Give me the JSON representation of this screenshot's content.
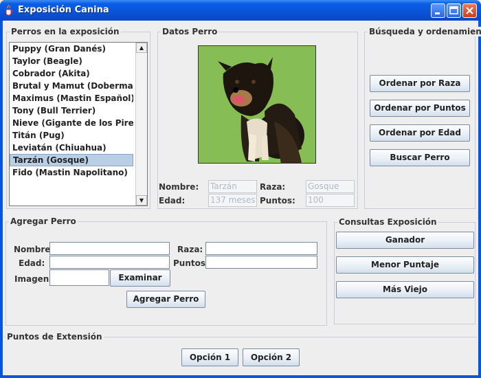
{
  "window": {
    "title": "Exposición Canina"
  },
  "perros_panel": {
    "title": "Perros en la exposición",
    "items": [
      "Puppy (Gran Danés)",
      "Taylor (Beagle)",
      "Cobrador (Akita)",
      "Brutal y Mamut (Doberman)",
      "Maximus (Mastin Español)",
      "Tony (Bull Terrier)",
      "Nieve (Gigante de los Pireneos)",
      "Titán (Pug)",
      "Leviatán (Chiuahua)",
      "Tarzán (Gosque)",
      "Fido (Mastin Napolitano)"
    ],
    "selected_index": 9
  },
  "datos_panel": {
    "title": "Datos Perro",
    "nombre_label": "Nombre:",
    "nombre_value": "Tarzán",
    "raza_label": "Raza:",
    "raza_value": "Gosque",
    "edad_label": "Edad:",
    "edad_value": "137 meses",
    "puntos_label": "Puntos:",
    "puntos_value": "100"
  },
  "busqueda_panel": {
    "title": "Búsqueda y ordenamientos",
    "buttons": [
      "Ordenar por Raza",
      "Ordenar por Puntos",
      "Ordenar por Edad",
      "Buscar Perro"
    ]
  },
  "agregar_panel": {
    "title": "Agregar Perro",
    "nombre_label": "Nombre:",
    "raza_label": "Raza:",
    "edad_label": "Edad:",
    "puntos_label": "Puntos:",
    "imagen_label": "Imagen:",
    "examinar": "Examinar",
    "agregar": "Agregar Perro"
  },
  "consultas_panel": {
    "title": "Consultas Exposición",
    "buttons": [
      "Ganador",
      "Menor Puntaje",
      "Más Viejo"
    ]
  },
  "extension_panel": {
    "title": "Puntos de Extensión",
    "buttons": [
      "Opción 1",
      "Opción 2"
    ]
  }
}
